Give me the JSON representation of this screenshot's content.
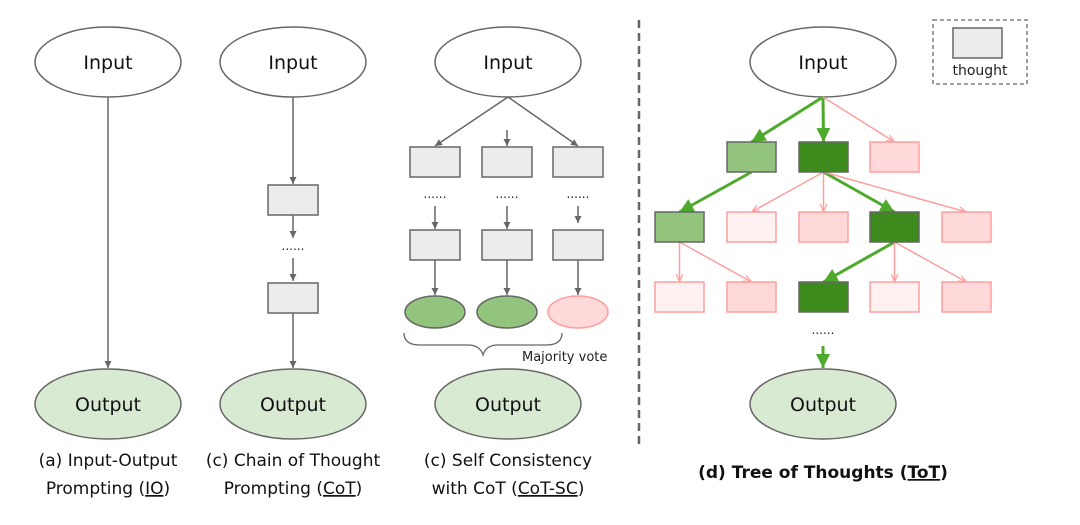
{
  "colors": {
    "stroke_gray": "#666666",
    "thought_fill": "#ececec",
    "output_fill": "#d9ead3",
    "green_light": "#93c47d",
    "green_dark": "#3d8b1c",
    "green_arrow": "#4eaa2b",
    "pink_fill": "#ffd9d9",
    "pink_pale": "#fff1f1",
    "pink_stroke": "#ff9e9e",
    "divider": "#666666"
  },
  "labels": {
    "input": "Input",
    "output": "Output",
    "dots": "......",
    "majority_vote": "Majority vote",
    "legend_thought": "thought"
  },
  "panels": {
    "io": {
      "caption_line1": "(a) Input-Output",
      "caption_line2_prefix": "Prompting (",
      "caption_line2_abbr": "IO",
      "caption_line2_suffix": ")"
    },
    "cot": {
      "caption_line1": "(c) Chain of Thought",
      "caption_line2_prefix": "Prompting (",
      "caption_line2_abbr": "CoT",
      "caption_line2_suffix": ")"
    },
    "cot_sc": {
      "caption_line1": "(c) Self Consistency",
      "caption_line2_prefix": "with CoT (",
      "caption_line2_abbr": "CoT-SC",
      "caption_line2_suffix": ")",
      "chains": [
        {
          "result": "accepted"
        },
        {
          "result": "accepted"
        },
        {
          "result": "rejected"
        }
      ]
    },
    "tot": {
      "caption_prefix": "(d) Tree of Thoughts (",
      "caption_abbr": "ToT",
      "caption_suffix": ")",
      "levels": [
        [
          "green_light",
          "green_dark",
          "pink"
        ],
        [
          "green_light",
          "pink_pale",
          "pink",
          "green_dark",
          "pink"
        ],
        [
          "pink_pale",
          "pink",
          "green_dark",
          "pink_pale",
          "pink"
        ]
      ],
      "edges": [
        {
          "from": "input",
          "to": [
            0,
            0
          ],
          "kind": "selected"
        },
        {
          "from": "input",
          "to": [
            0,
            1
          ],
          "kind": "selected"
        },
        {
          "from": "input",
          "to": [
            0,
            2
          ],
          "kind": "pruned"
        },
        {
          "from": [
            0,
            0
          ],
          "to": [
            1,
            0
          ],
          "kind": "selected"
        },
        {
          "from": [
            0,
            1
          ],
          "to": [
            1,
            1
          ],
          "kind": "pruned"
        },
        {
          "from": [
            0,
            1
          ],
          "to": [
            1,
            2
          ],
          "kind": "pruned"
        },
        {
          "from": [
            0,
            1
          ],
          "to": [
            1,
            3
          ],
          "kind": "selected"
        },
        {
          "from": [
            0,
            1
          ],
          "to": [
            1,
            4
          ],
          "kind": "pruned"
        },
        {
          "from": [
            1,
            0
          ],
          "to": [
            2,
            0
          ],
          "kind": "pruned"
        },
        {
          "from": [
            1,
            0
          ],
          "to": [
            2,
            1
          ],
          "kind": "pruned"
        },
        {
          "from": [
            1,
            3
          ],
          "to": [
            2,
            2
          ],
          "kind": "selected"
        },
        {
          "from": [
            1,
            3
          ],
          "to": [
            2,
            3
          ],
          "kind": "pruned"
        },
        {
          "from": [
            1,
            3
          ],
          "to": [
            2,
            4
          ],
          "kind": "pruned"
        }
      ]
    }
  }
}
